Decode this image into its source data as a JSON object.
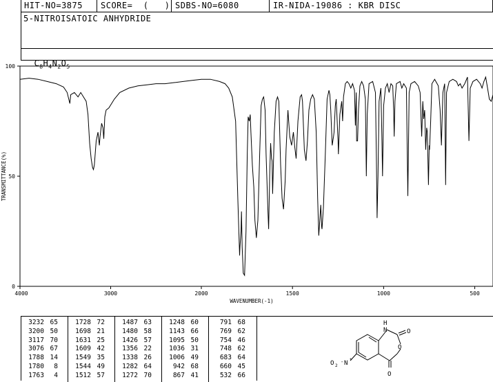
{
  "header": {
    "hit_no": "HIT-NO=3875",
    "score": "SCORE=  (   )",
    "sdbs_no": "SDBS-NO=6080",
    "ir_nida": "IR-NIDA-19086 : KBR DISC"
  },
  "compound_name": "5-NITROISATOIC ANHYDRIDE",
  "formula": {
    "parts": [
      "C",
      "8",
      "H",
      "4",
      "N",
      "2",
      "O",
      "5"
    ]
  },
  "chart_data": {
    "type": "line",
    "xlabel": "WAVENUMBER(-1)",
    "ylabel": "TRANSMITTANCE(%)",
    "xlim": [
      4000,
      400
    ],
    "ylim": [
      0,
      100
    ],
    "x_ticks": [
      "4000",
      "3000",
      "2000",
      "1500",
      "1000",
      "500"
    ],
    "y_ticks": [
      "100",
      "50",
      "0"
    ],
    "points": [
      [
        4000,
        94
      ],
      [
        3900,
        94.5
      ],
      [
        3800,
        94
      ],
      [
        3700,
        93
      ],
      [
        3600,
        92
      ],
      [
        3520,
        90.5
      ],
      [
        3480,
        88
      ],
      [
        3450,
        83
      ],
      [
        3440,
        87
      ],
      [
        3400,
        88
      ],
      [
        3360,
        86
      ],
      [
        3330,
        88
      ],
      [
        3300,
        86
      ],
      [
        3270,
        84
      ],
      [
        3250,
        78
      ],
      [
        3232,
        65
      ],
      [
        3215,
        58
      ],
      [
        3200,
        54
      ],
      [
        3190,
        53
      ],
      [
        3180,
        55
      ],
      [
        3160,
        66
      ],
      [
        3140,
        70
      ],
      [
        3125,
        64
      ],
      [
        3117,
        68
      ],
      [
        3100,
        74
      ],
      [
        3085,
        72
      ],
      [
        3076,
        67
      ],
      [
        3065,
        77
      ],
      [
        3050,
        80
      ],
      [
        3020,
        81
      ],
      [
        2960,
        85
      ],
      [
        2900,
        88
      ],
      [
        2800,
        90
      ],
      [
        2700,
        91
      ],
      [
        2600,
        91.5
      ],
      [
        2500,
        92
      ],
      [
        2400,
        92
      ],
      [
        2300,
        92.5
      ],
      [
        2200,
        93
      ],
      [
        2100,
        93.5
      ],
      [
        2000,
        94
      ],
      [
        1950,
        94
      ],
      [
        1900,
        93
      ],
      [
        1870,
        92
      ],
      [
        1850,
        90
      ],
      [
        1830,
        86
      ],
      [
        1812,
        75
      ],
      [
        1800,
        40
      ],
      [
        1790,
        14
      ],
      [
        1788,
        18
      ],
      [
        1782,
        25
      ],
      [
        1780,
        34
      ],
      [
        1776,
        18
      ],
      [
        1770,
        6
      ],
      [
        1763,
        5
      ],
      [
        1755,
        25
      ],
      [
        1748,
        60
      ],
      [
        1743,
        77
      ],
      [
        1737,
        75
      ],
      [
        1732,
        78
      ],
      [
        1728,
        70
      ],
      [
        1720,
        55
      ],
      [
        1712,
        45
      ],
      [
        1706,
        30
      ],
      [
        1698,
        22
      ],
      [
        1690,
        30
      ],
      [
        1680,
        60
      ],
      [
        1672,
        82
      ],
      [
        1665,
        85
      ],
      [
        1658,
        86
      ],
      [
        1650,
        80
      ],
      [
        1645,
        60
      ],
      [
        1635,
        35
      ],
      [
        1631,
        26
      ],
      [
        1625,
        50
      ],
      [
        1620,
        65
      ],
      [
        1615,
        58
      ],
      [
        1612,
        57
      ],
      [
        1609,
        42
      ],
      [
        1600,
        70
      ],
      [
        1590,
        84
      ],
      [
        1582,
        86
      ],
      [
        1575,
        84
      ],
      [
        1565,
        55
      ],
      [
        1557,
        40
      ],
      [
        1549,
        35
      ],
      [
        1540,
        48
      ],
      [
        1535,
        62
      ],
      [
        1525,
        80
      ],
      [
        1515,
        68
      ],
      [
        1505,
        64
      ],
      [
        1495,
        70
      ],
      [
        1487,
        63
      ],
      [
        1480,
        58
      ],
      [
        1470,
        75
      ],
      [
        1458,
        86
      ],
      [
        1450,
        87
      ],
      [
        1445,
        84
      ],
      [
        1435,
        62
      ],
      [
        1426,
        57
      ],
      [
        1418,
        66
      ],
      [
        1410,
        80
      ],
      [
        1400,
        85
      ],
      [
        1390,
        87
      ],
      [
        1380,
        85
      ],
      [
        1370,
        70
      ],
      [
        1362,
        40
      ],
      [
        1356,
        23
      ],
      [
        1350,
        30
      ],
      [
        1345,
        37
      ],
      [
        1340,
        27
      ],
      [
        1338,
        26
      ],
      [
        1330,
        36
      ],
      [
        1320,
        60
      ],
      [
        1310,
        85
      ],
      [
        1300,
        89
      ],
      [
        1295,
        87
      ],
      [
        1290,
        80
      ],
      [
        1282,
        64
      ],
      [
        1275,
        68
      ],
      [
        1272,
        70
      ],
      [
        1265,
        82
      ],
      [
        1260,
        85
      ],
      [
        1250,
        66
      ],
      [
        1248,
        60
      ],
      [
        1240,
        78
      ],
      [
        1230,
        84
      ],
      [
        1225,
        75
      ],
      [
        1220,
        86
      ],
      [
        1210,
        92
      ],
      [
        1200,
        93
      ],
      [
        1190,
        92
      ],
      [
        1180,
        90
      ],
      [
        1170,
        92
      ],
      [
        1160,
        89
      ],
      [
        1155,
        73
      ],
      [
        1150,
        88
      ],
      [
        1148,
        66
      ],
      [
        1143,
        66
      ],
      [
        1138,
        80
      ],
      [
        1130,
        91
      ],
      [
        1120,
        93
      ],
      [
        1110,
        91
      ],
      [
        1100,
        85
      ],
      [
        1095,
        50
      ],
      [
        1090,
        78
      ],
      [
        1080,
        92
      ],
      [
        1060,
        93
      ],
      [
        1045,
        88
      ],
      [
        1040,
        60
      ],
      [
        1036,
        31
      ],
      [
        1031,
        50
      ],
      [
        1025,
        84
      ],
      [
        1015,
        90
      ],
      [
        1010,
        70
      ],
      [
        1006,
        50
      ],
      [
        1000,
        82
      ],
      [
        990,
        90
      ],
      [
        980,
        92
      ],
      [
        970,
        88
      ],
      [
        960,
        92
      ],
      [
        950,
        91
      ],
      [
        945,
        80
      ],
      [
        942,
        68
      ],
      [
        938,
        84
      ],
      [
        930,
        92
      ],
      [
        910,
        93
      ],
      [
        900,
        90
      ],
      [
        890,
        92
      ],
      [
        875,
        90
      ],
      [
        867,
        41
      ],
      [
        860,
        88
      ],
      [
        850,
        92
      ],
      [
        830,
        93
      ],
      [
        810,
        91
      ],
      [
        800,
        88
      ],
      [
        791,
        68
      ],
      [
        785,
        84
      ],
      [
        780,
        76
      ],
      [
        775,
        80
      ],
      [
        769,
        62
      ],
      [
        764,
        72
      ],
      [
        760,
        70
      ],
      [
        754,
        46
      ],
      [
        750,
        64
      ],
      [
        748,
        62
      ],
      [
        742,
        75
      ],
      [
        735,
        92
      ],
      [
        720,
        94
      ],
      [
        700,
        91
      ],
      [
        690,
        80
      ],
      [
        683,
        64
      ],
      [
        675,
        88
      ],
      [
        665,
        92
      ],
      [
        660,
        46
      ],
      [
        655,
        88
      ],
      [
        640,
        93
      ],
      [
        620,
        94
      ],
      [
        600,
        93
      ],
      [
        590,
        91
      ],
      [
        580,
        92
      ],
      [
        570,
        90
      ],
      [
        555,
        92
      ],
      [
        540,
        95
      ],
      [
        532,
        66
      ],
      [
        525,
        90
      ],
      [
        510,
        93
      ],
      [
        490,
        94
      ],
      [
        470,
        92
      ],
      [
        460,
        90
      ],
      [
        450,
        93
      ],
      [
        440,
        95
      ],
      [
        430,
        90
      ],
      [
        420,
        85
      ],
      [
        410,
        84
      ],
      [
        400,
        87
      ]
    ],
    "peak_table": [
      [
        [
          "3232",
          "65"
        ],
        [
          "3200",
          "50"
        ],
        [
          "3117",
          "70"
        ],
        [
          "3076",
          "67"
        ],
        [
          "1788",
          "14"
        ],
        [
          "1780",
          "8"
        ],
        [
          "1763",
          "4"
        ]
      ],
      [
        [
          "1728",
          "72"
        ],
        [
          "1698",
          "21"
        ],
        [
          "1631",
          "25"
        ],
        [
          "1609",
          "42"
        ],
        [
          "1549",
          "35"
        ],
        [
          "1544",
          "49"
        ],
        [
          "1512",
          "57"
        ]
      ],
      [
        [
          "1487",
          "63"
        ],
        [
          "1480",
          "58"
        ],
        [
          "1426",
          "57"
        ],
        [
          "1356",
          "22"
        ],
        [
          "1338",
          "26"
        ],
        [
          "1282",
          "64"
        ],
        [
          "1272",
          "70"
        ]
      ],
      [
        [
          "1248",
          "60"
        ],
        [
          "1143",
          "66"
        ],
        [
          "1095",
          "50"
        ],
        [
          "1036",
          "31"
        ],
        [
          "1006",
          "49"
        ],
        [
          "942",
          "68"
        ],
        [
          "867",
          "41"
        ]
      ],
      [
        [
          "791",
          "68"
        ],
        [
          "769",
          "62"
        ],
        [
          "754",
          "46"
        ],
        [
          "748",
          "62"
        ],
        [
          "683",
          "64"
        ],
        [
          "660",
          "45"
        ],
        [
          "532",
          "66"
        ]
      ]
    ]
  },
  "structure": {
    "labels": {
      "nh": "H",
      "n": "N",
      "o_top": "O",
      "o_ring": "O",
      "o_bottom": "O",
      "nitro": "O",
      "nitro_n": "N"
    }
  }
}
